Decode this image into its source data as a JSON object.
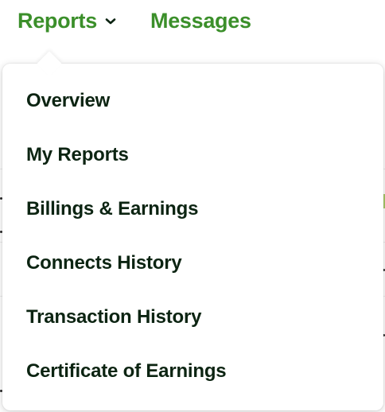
{
  "nav": {
    "reports_label": "Reports",
    "messages_label": "Messages",
    "accent_color": "#3b8f2a"
  },
  "dropdown": {
    "items": [
      {
        "label": "Overview"
      },
      {
        "label": "My Reports"
      },
      {
        "label": "Billings & Earnings"
      },
      {
        "label": "Connects History"
      },
      {
        "label": "Transaction History"
      },
      {
        "label": "Certificate of Earnings"
      }
    ],
    "text_color": "#0c2412"
  }
}
